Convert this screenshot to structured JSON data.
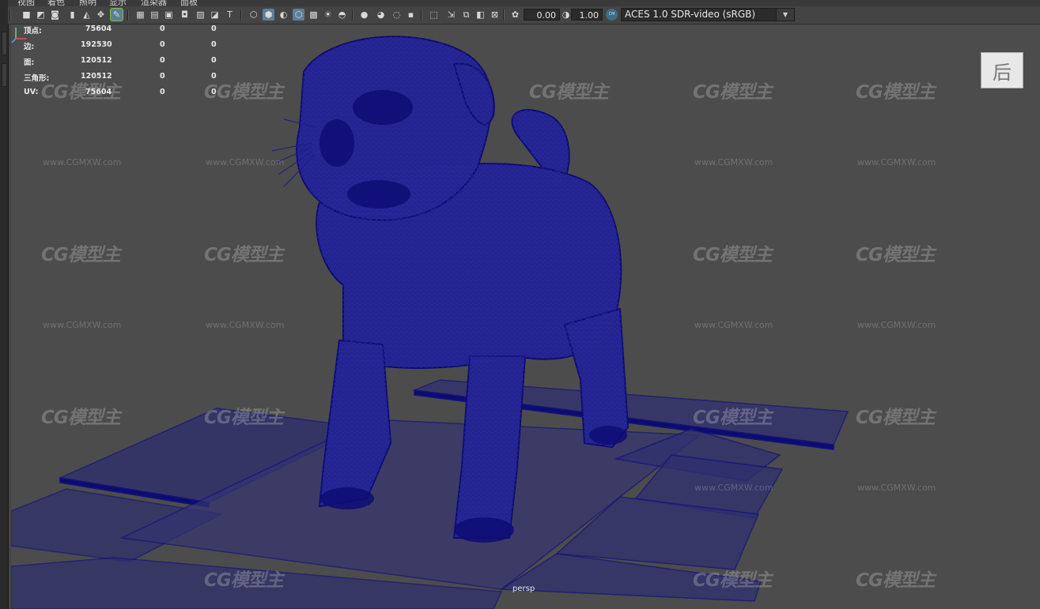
{
  "menu": [
    "视图",
    "着色",
    "照明",
    "显示",
    "渲染器",
    "面板"
  ],
  "toolbar": {
    "icons": [
      "camera-icon",
      "camera-attributes-icon",
      "bookmark-camera-icon",
      "bookmark-icon",
      "image-plane-icon",
      "2d-pan-zoom-icon",
      "grease-pencil-icon",
      "grid-icon",
      "film-gate-icon",
      "resolution-gate-icon",
      "gate-mask-icon",
      "field-chart-icon",
      "safe-action-icon",
      "safe-title-icon",
      "wireframe-icon",
      "smooth-shade-icon",
      "use-default-material-icon",
      "wireframe-on-shaded-icon",
      "xray-icon",
      "xray-joints-icon",
      "use-all-lights-icon",
      "shadows-icon",
      "screen-space-ao-icon",
      "motion-blur-icon",
      "anti-aliasing-icon",
      "depth-of-field-icon",
      "isolate-select-icon",
      "xray-active-icon",
      "hud-icon",
      "backface-culling-icon",
      "exposure-icon",
      "gamma-icon"
    ],
    "exposure_value": "0.00",
    "gamma_value": "1.00",
    "color_space": "ACES 1.0 SDR-video (sRGB)",
    "color_space_badge": "CM"
  },
  "hud": {
    "rows": [
      {
        "label": "顶点:",
        "value": "75604",
        "col2": "0",
        "col3": "0"
      },
      {
        "label": "边:",
        "value": "192530",
        "col2": "0",
        "col3": "0"
      },
      {
        "label": "面:",
        "value": "120512",
        "col2": "0",
        "col3": "0"
      },
      {
        "label": "三角形:",
        "value": "120512",
        "col2": "0",
        "col3": "0"
      },
      {
        "label": "UV:",
        "value": "75604",
        "col2": "0",
        "col3": "0"
      }
    ]
  },
  "camera_label": "persp",
  "watermark": {
    "logo": "CG模型主",
    "url": "www.CGMXW.com"
  },
  "corner_badge": "后",
  "colors": {
    "wire": "#0a0a7a",
    "viewport_bg": "#4c4c4c",
    "toolbar_bg": "#444444"
  }
}
